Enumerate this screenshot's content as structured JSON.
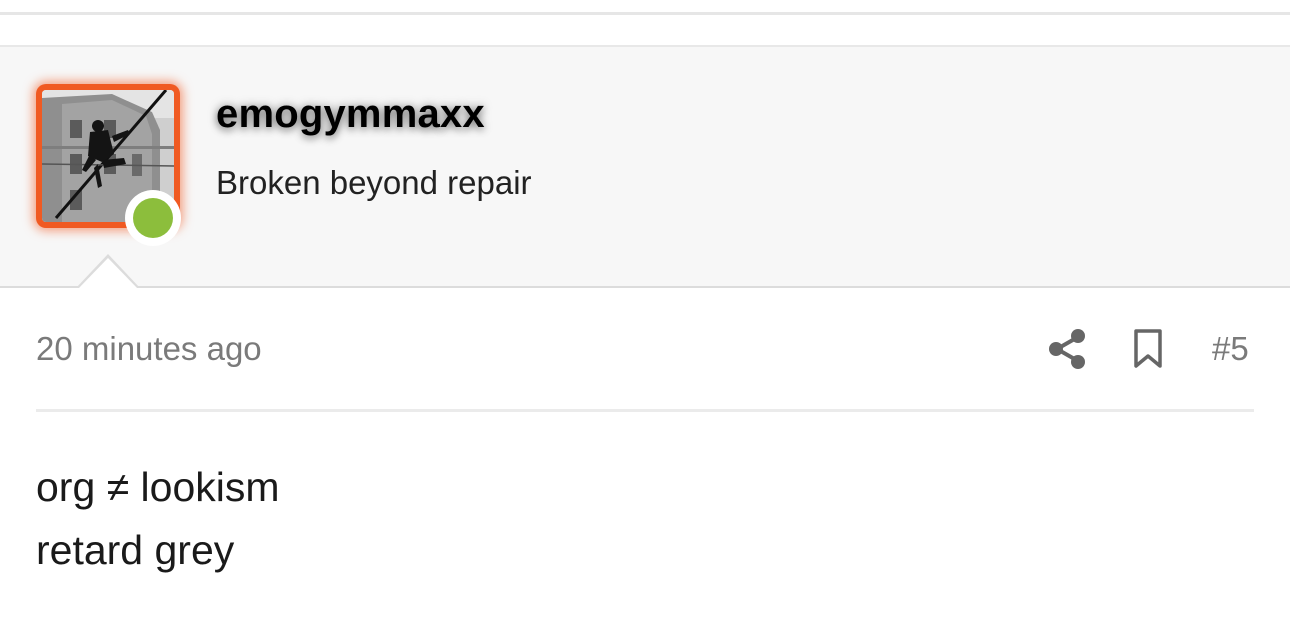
{
  "post": {
    "author": {
      "username": "emogymmaxx",
      "title": "Broken beyond repair",
      "online": true,
      "avatar_frame_color": "#f05a22",
      "online_color": "#8cbe3c"
    },
    "timestamp": "20 minutes ago",
    "post_number": "#5",
    "actions": {
      "share_icon": "share-icon",
      "bookmark_icon": "bookmark-icon"
    },
    "body": {
      "lines": [
        "org ≠ lookism",
        "retard grey"
      ]
    }
  }
}
